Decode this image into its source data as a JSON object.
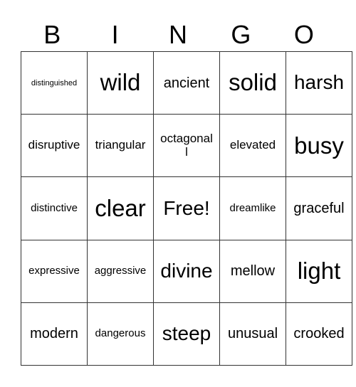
{
  "header": [
    "B",
    "I",
    "N",
    "G",
    "O"
  ],
  "rows": [
    [
      {
        "text": "distinguished",
        "size": "xs"
      },
      {
        "text": "wild",
        "size": "xxl"
      },
      {
        "text": "ancient",
        "size": "l"
      },
      {
        "text": "solid",
        "size": "xxl"
      },
      {
        "text": "harsh",
        "size": "xl"
      }
    ],
    [
      {
        "text": "disruptive",
        "size": "m"
      },
      {
        "text": "triangular",
        "size": "m"
      },
      {
        "text": "octagonal\nl",
        "size": "m"
      },
      {
        "text": "elevated",
        "size": "m"
      },
      {
        "text": "busy",
        "size": "xxl"
      }
    ],
    [
      {
        "text": "distinctive",
        "size": "s"
      },
      {
        "text": "clear",
        "size": "xxl"
      },
      {
        "text": "Free!",
        "size": "xl"
      },
      {
        "text": "dreamlike",
        "size": "s"
      },
      {
        "text": "graceful",
        "size": "l"
      }
    ],
    [
      {
        "text": "expressive",
        "size": "s"
      },
      {
        "text": "aggressive",
        "size": "s"
      },
      {
        "text": "divine",
        "size": "xl"
      },
      {
        "text": "mellow",
        "size": "l"
      },
      {
        "text": "light",
        "size": "xxl"
      }
    ],
    [
      {
        "text": "modern",
        "size": "l"
      },
      {
        "text": "dangerous",
        "size": "s"
      },
      {
        "text": "steep",
        "size": "xl"
      },
      {
        "text": "unusual",
        "size": "l"
      },
      {
        "text": "crooked",
        "size": "l"
      }
    ]
  ]
}
